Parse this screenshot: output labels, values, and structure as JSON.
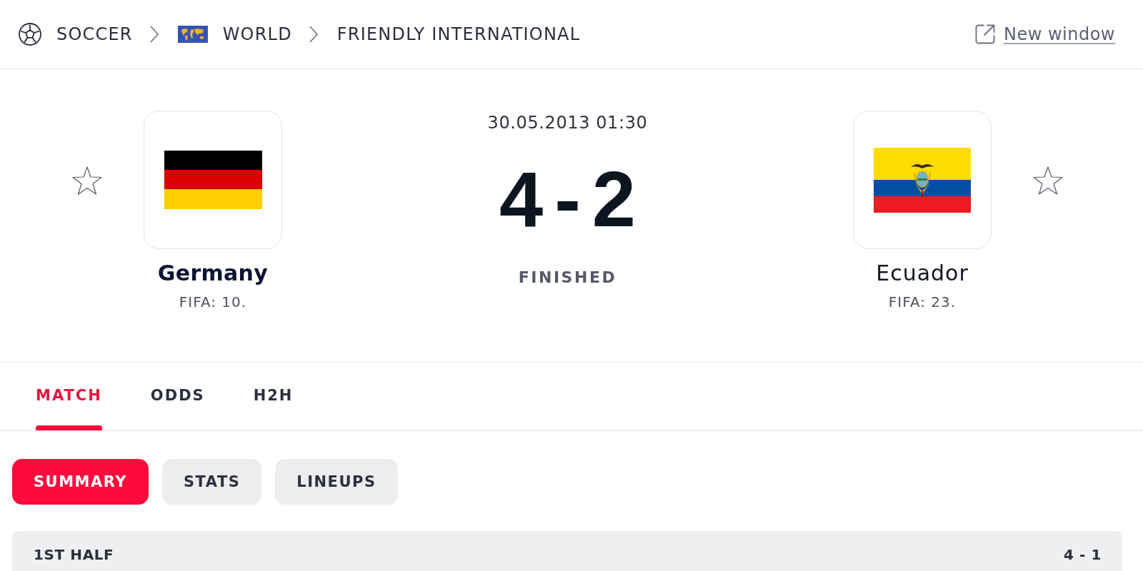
{
  "breadcrumb": [
    {
      "kind": "sport",
      "label": "SOCCER"
    },
    {
      "kind": "region",
      "label": "WORLD"
    },
    {
      "kind": "league",
      "label": "FRIENDLY INTERNATIONAL"
    }
  ],
  "new_window_link": {
    "label": "New window"
  },
  "match": {
    "date": "30.05.2013 01:30",
    "score": {
      "home": "4",
      "separator": "-",
      "away": "2"
    },
    "status": "FINISHED",
    "teams": [
      {
        "kind": "germany",
        "name": "Germany",
        "rank": "FIFA: 10.",
        "winner": true,
        "favorite": false
      },
      {
        "kind": "ecuador",
        "name": "Ecuador",
        "rank": "FIFA: 23.",
        "winner": false,
        "favorite": false
      }
    ]
  },
  "tabs": [
    {
      "label": "MATCH",
      "selected": true
    },
    {
      "label": "ODDS",
      "selected": false
    },
    {
      "label": "H2H",
      "selected": false
    }
  ],
  "subtabs": [
    {
      "label": "SUMMARY",
      "selected": true
    },
    {
      "label": "STATS",
      "selected": false
    },
    {
      "label": "LINEUPS",
      "selected": false
    }
  ],
  "period": {
    "title": "1ST HALF",
    "score": "4 - 1"
  }
}
